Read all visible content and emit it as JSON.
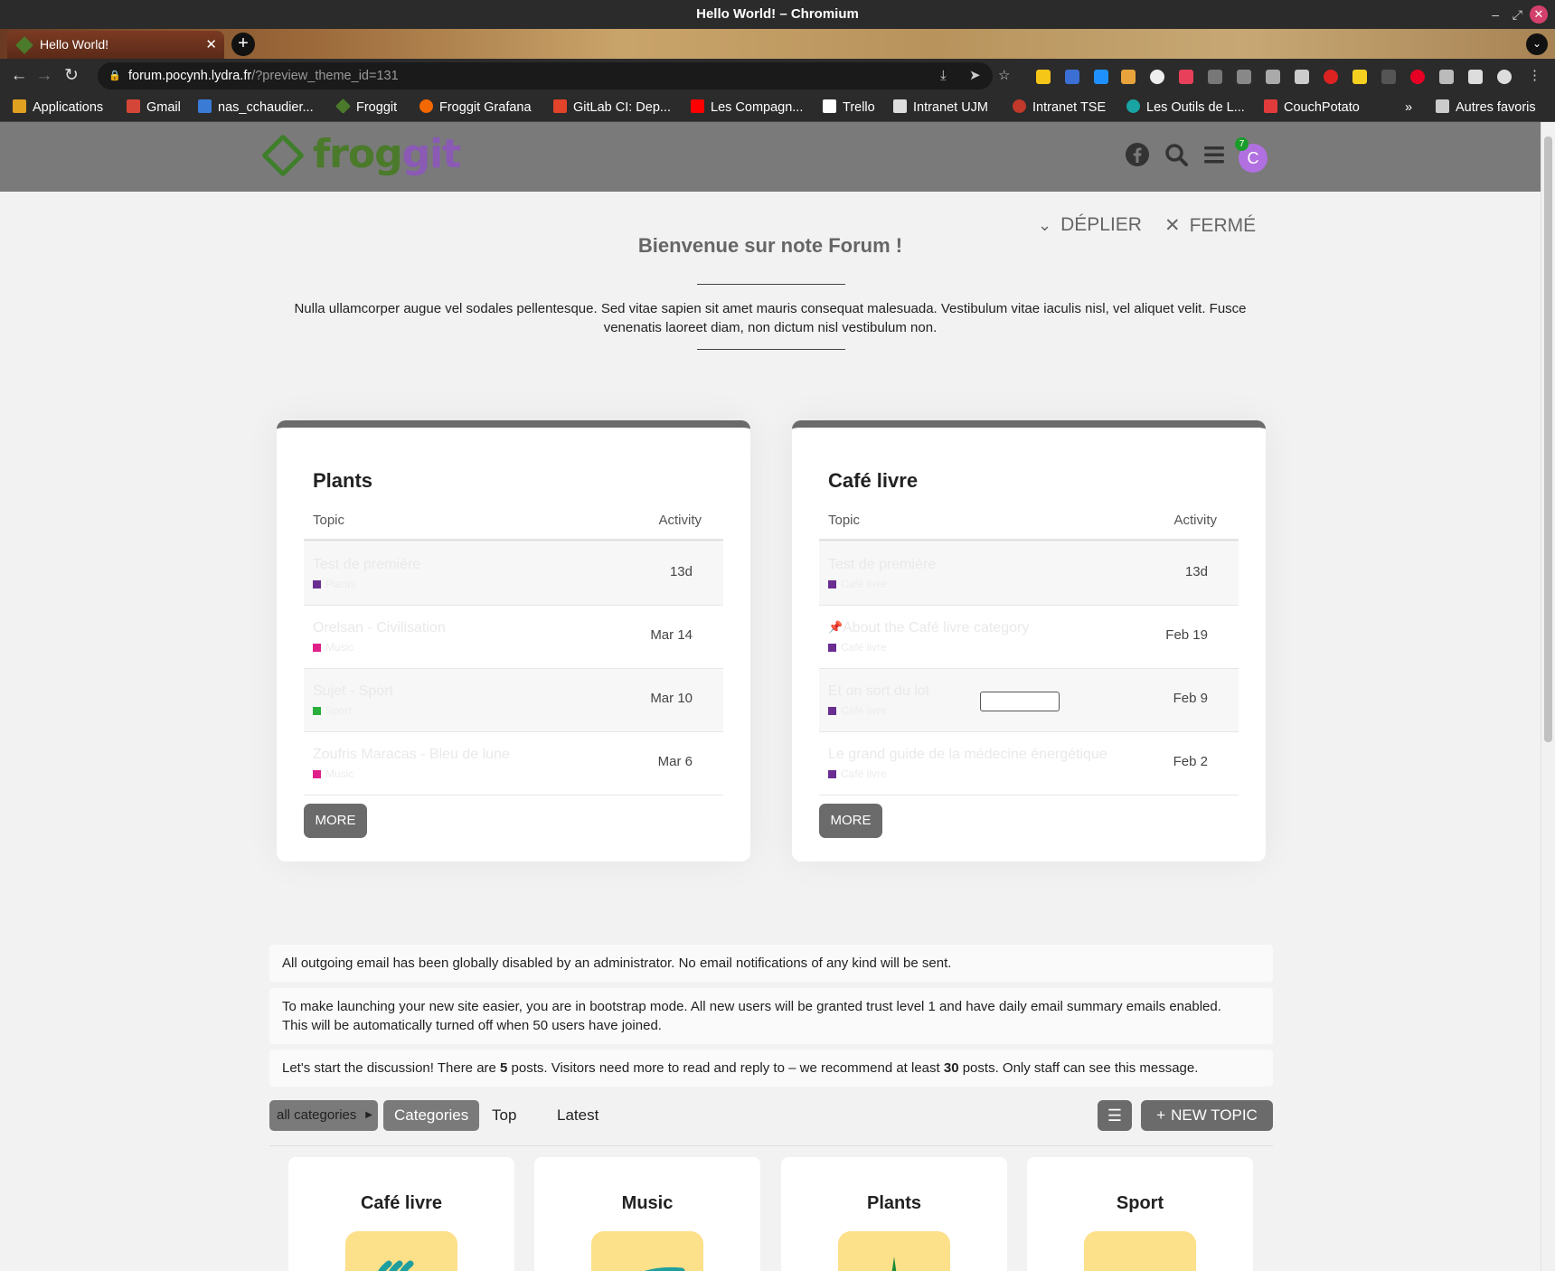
{
  "window": {
    "title": "Hello World! – Chromium"
  },
  "tab": {
    "title": "Hello World!"
  },
  "address": {
    "host": "forum.pocynh.lydra.fr",
    "path": "/?preview_theme_id=131"
  },
  "bookmarks": [
    {
      "label": "Applications",
      "color": "#e0e0e0"
    },
    {
      "label": "Gmail",
      "color": "#d44638"
    },
    {
      "label": "nas_cchaudier...",
      "color": "#3a7bd5"
    },
    {
      "label": "Froggit",
      "color": "#4a7a2a"
    },
    {
      "label": "Froggit Grafana",
      "color": "#f46800"
    },
    {
      "label": "GitLab CI: Dep...",
      "color": "#e24329"
    },
    {
      "label": "Les Compagn...",
      "color": "#ff0000"
    },
    {
      "label": "Trello",
      "color": "#ffffff"
    },
    {
      "label": "Intranet UJM",
      "color": "#dddddd"
    },
    {
      "label": "Intranet TSE",
      "color": "#c0392b"
    },
    {
      "label": "Les Outils de L...",
      "color": "#1aa3a3"
    },
    {
      "label": "CouchPotato",
      "color": "#e23b3b"
    },
    {
      "label": "Autres favoris",
      "color": "#dddddd"
    }
  ],
  "overflow_glyph": "»",
  "header": {
    "logo_text_a": "frog",
    "logo_text_b": "git",
    "notif_count": "7",
    "avatar_letter": "C"
  },
  "banner": {
    "toggle_label": "DÉPLIER",
    "close_label": "FERMÉ",
    "title": "Bienvenue sur note Forum !",
    "text": "Nulla ullamcorper augue vel sodales pellentesque. Sed vitae sapien sit amet mauris consequat malesuada. Vestibulum vitae iaculis nisl, vel aliquet velit. Fusce venenatis laoreet diam, non dictum nisl vestibulum non."
  },
  "cards": [
    {
      "title": "Plants",
      "col_topic": "Topic",
      "col_activity": "Activity",
      "more": "MORE",
      "rows": [
        {
          "title": "Test de première",
          "category": "Plants",
          "color": "#6a2d91",
          "activity": "13d"
        },
        {
          "title": "Orelsan - Civilisation",
          "category": "Music",
          "color": "#e0208a",
          "activity": "Mar 14"
        },
        {
          "title": "Sujet - Sport",
          "category": "Sport",
          "color": "#2ab03a",
          "activity": "Mar 10"
        },
        {
          "title": "Zoufris Maracas - Bleu de lune",
          "category": "Music",
          "color": "#e0208a",
          "activity": "Mar 6"
        }
      ]
    },
    {
      "title": "Café livre",
      "col_topic": "Topic",
      "col_activity": "Activity",
      "more": "MORE",
      "rows": [
        {
          "title": "Test de première",
          "category": "Café livre",
          "color": "#6a2d91",
          "activity": "13d"
        },
        {
          "title": "About the Café livre category",
          "category": "Café livre",
          "color": "#6a2d91",
          "activity": "Feb 19"
        },
        {
          "title": "Et on sort du lot",
          "category": "Café livre",
          "color": "#6a2d91",
          "activity": "Feb 9"
        },
        {
          "title": "Le grand guide de la médecine énergétique",
          "category": "Café livre",
          "color": "#6a2d91",
          "activity": "Feb 2"
        }
      ]
    }
  ],
  "notices": {
    "email": "All outgoing email has been globally disabled by an administrator. No email notifications of any kind will be sent.",
    "bootstrap_a": "To make launching your new site easier, you are in bootstrap mode. All new users will be granted trust level 1 and have daily email summary emails enabled.",
    "bootstrap_b": "This will be automatically turned off when 50 users have joined.",
    "discuss_a": "Let's start the discussion! There are ",
    "discuss_posts": "5",
    "discuss_b": " posts. Visitors need more to read and reply to – we recommend at least ",
    "discuss_rec": "30",
    "discuss_c": " posts. Only staff can see this message."
  },
  "nav": {
    "all_categories": "all categories",
    "categories": "Categories",
    "top": "Top",
    "latest": "Latest",
    "new_topic": "NEW TOPIC"
  },
  "categories": [
    {
      "name": "Café livre"
    },
    {
      "name": "Music"
    },
    {
      "name": "Plants"
    },
    {
      "name": "Sport"
    }
  ]
}
